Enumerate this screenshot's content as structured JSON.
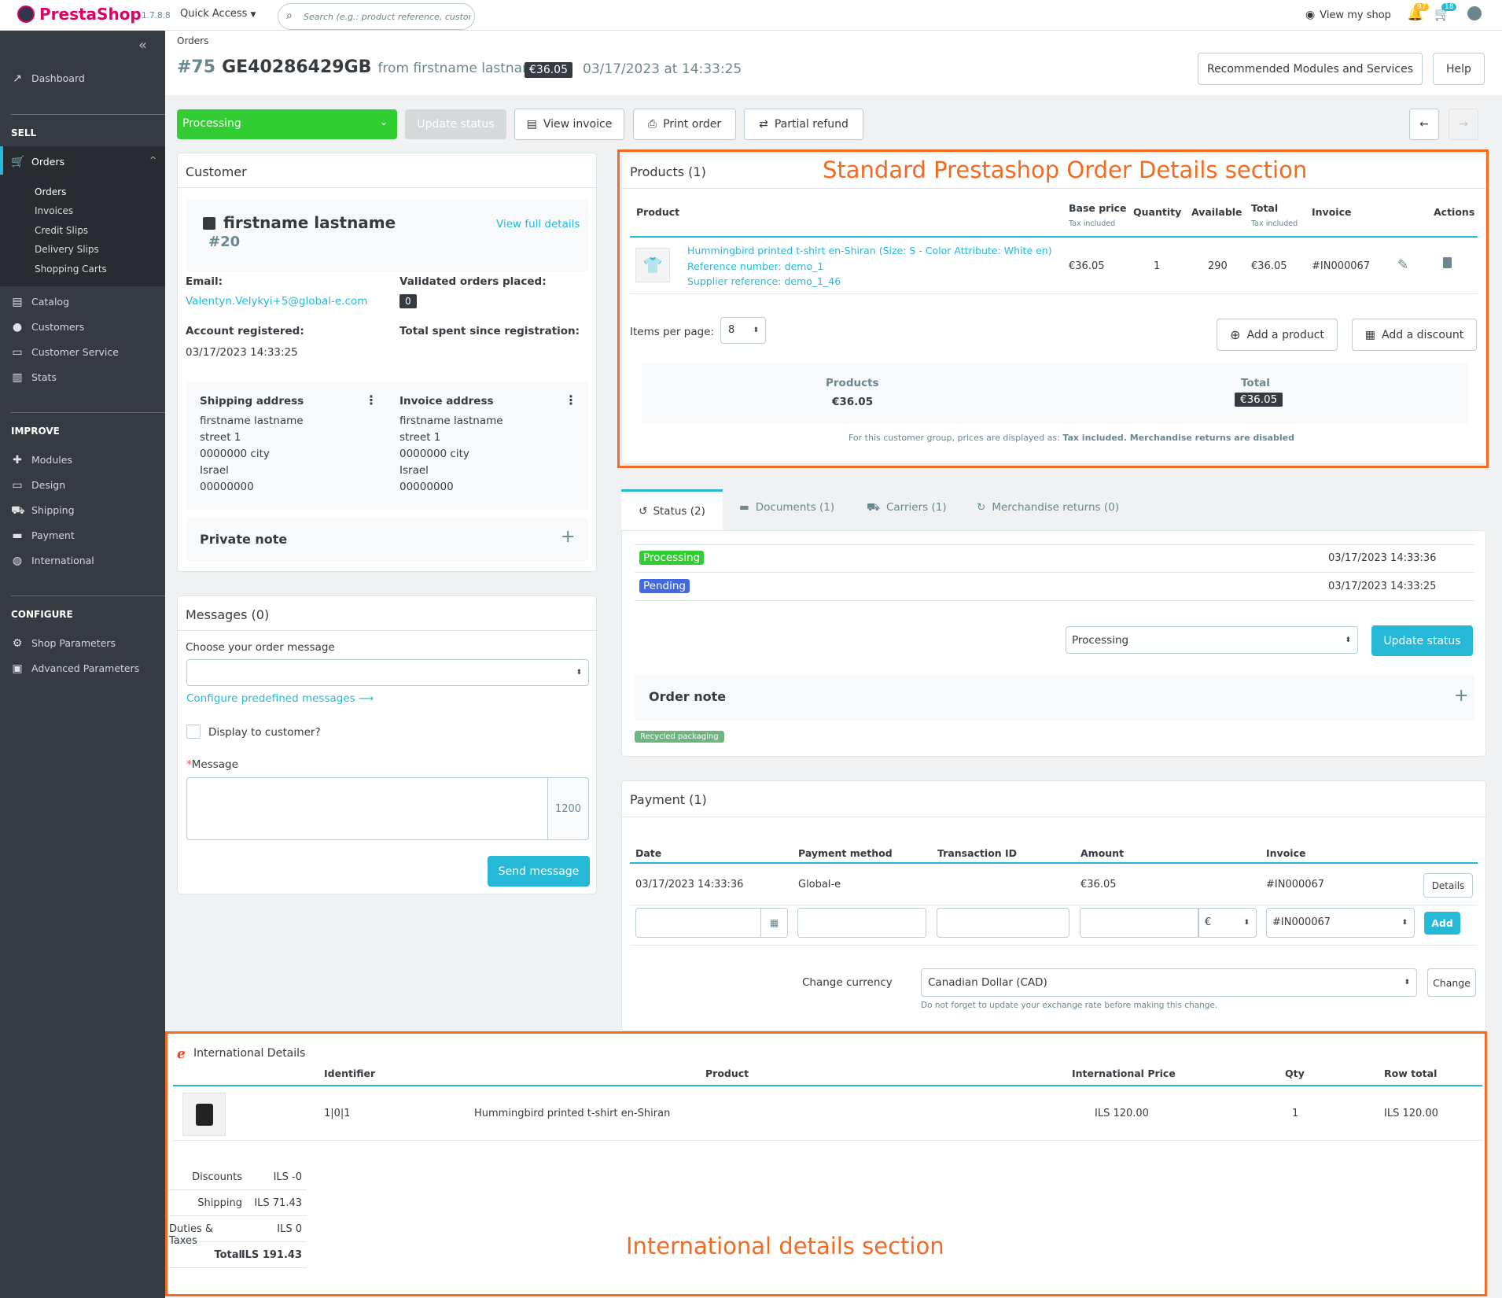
{
  "topbar": {
    "logo_text": "PrestaShop",
    "version": "1.7.8.8",
    "quick_access": "Quick Access",
    "search_placeholder": "Search (e.g.: product reference, custon",
    "view_shop": "View my shop",
    "notif_orders": "97",
    "notif_customers": "18"
  },
  "sidebar": {
    "dashboard": "Dashboard",
    "sell": "SELL",
    "orders": "Orders",
    "orders_sub": [
      "Orders",
      "Invoices",
      "Credit Slips",
      "Delivery Slips",
      "Shopping Carts"
    ],
    "catalog": "Catalog",
    "customers": "Customers",
    "customer_service": "Customer Service",
    "stats": "Stats",
    "improve": "IMPROVE",
    "modules": "Modules",
    "design": "Design",
    "shipping": "Shipping",
    "payment": "Payment",
    "international": "International",
    "configure": "CONFIGURE",
    "shop_parameters": "Shop Parameters",
    "advanced_parameters": "Advanced Parameters"
  },
  "header": {
    "breadcrumb": "Orders",
    "order_number": "#75",
    "order_reference": "GE40286429GB",
    "from": "from firstname lastname",
    "total_badge": "€36.05",
    "date": "03/17/2023 at 14:33:25",
    "recommended": "Recommended Modules and Services",
    "help": "Help"
  },
  "actions": {
    "status_select": "Processing",
    "update_status": "Update status",
    "view_invoice": "View invoice",
    "print_order": "Print order",
    "partial_refund": "Partial refund"
  },
  "customer": {
    "title": "Customer",
    "name": "firstname lastname",
    "id": "#20",
    "view_full": "View full details",
    "email_label": "Email:",
    "email": "Valentyn.Velykyi+5@global-e.com",
    "validated_label": "Validated orders placed:",
    "validated_count": "0",
    "registered_label": "Account registered:",
    "registered": "03/17/2023 14:33:25",
    "total_spent_label": "Total spent since registration:",
    "shipping_title": "Shipping address",
    "invoice_title": "Invoice address",
    "shipping_lines": [
      "firstname lastname",
      "street 1",
      "0000000 city",
      "Israel",
      "00000000"
    ],
    "invoice_lines": [
      "firstname lastname",
      "street 1",
      "0000000 city",
      "Israel",
      "00000000"
    ],
    "private_note": "Private note"
  },
  "messages": {
    "title": "Messages (0)",
    "choose_label": "Choose your order message",
    "configure_link": "Configure predefined messages",
    "display_label": "Display to customer?",
    "message_label": "Message",
    "counter": "1200",
    "send": "Send message"
  },
  "products": {
    "title": "Products (1)",
    "headers": {
      "product": "Product",
      "base_price": "Base price",
      "base_price_sub": "Tax included",
      "quantity": "Quantity",
      "available": "Available",
      "total": "Total",
      "total_sub": "Tax included",
      "invoice": "Invoice",
      "actions": "Actions"
    },
    "row": {
      "name": "Hummingbird printed t-shirt en-Shiran (Size: S - Color Attribute: White en)",
      "reference": "Reference number: demo_1",
      "supplier": "Supplier reference: demo_1_46",
      "base_price": "€36.05",
      "quantity": "1",
      "available": "290",
      "total": "€36.05",
      "invoice": "#IN000067"
    },
    "items_per_page_label": "Items per page:",
    "items_per_page": "8",
    "add_product": "Add a product",
    "add_discount": "Add a discount",
    "summary_products_label": "Products",
    "summary_products_value": "€36.05",
    "summary_total_label": "Total",
    "summary_total_value": "€36.05",
    "note_prefix": "For this customer group, prices are displayed as: ",
    "note_bold": "Tax included. Merchandise returns are disabled"
  },
  "annotation_top": "Standard Prestashop Order Details section",
  "annotation_bottom": "International details section",
  "tabs": {
    "status": "Status (2)",
    "documents": "Documents (1)",
    "carriers": "Carriers (1)",
    "returns": "Merchandise returns (0)"
  },
  "status_history": [
    {
      "label": "Processing",
      "date": "03/17/2023 14:33:36",
      "color": "#32cd32"
    },
    {
      "label": "Pending",
      "date": "03/17/2023 14:33:25",
      "color": "#4169e1"
    }
  ],
  "status_update": {
    "select": "Processing",
    "button": "Update status"
  },
  "order_note": "Order note",
  "recycled": "Recycled packaging",
  "payment": {
    "title": "Payment (1)",
    "headers": {
      "date": "Date",
      "method": "Payment method",
      "transaction": "Transaction ID",
      "amount": "Amount",
      "invoice": "Invoice"
    },
    "row": {
      "date": "03/17/2023 14:33:36",
      "method": "Global-e",
      "amount": "€36.05",
      "invoice": "#IN000067",
      "details": "Details"
    },
    "currency_symbol": "€",
    "invoice_select": "#IN000067",
    "add": "Add",
    "change_currency_label": "Change currency",
    "currency": "Canadian Dollar (CAD)",
    "change": "Change",
    "currency_note": "Do not forget to update your exchange rate before making this change."
  },
  "international": {
    "title": "International Details",
    "headers": {
      "identifier": "Identifier",
      "product": "Product",
      "price": "International Price",
      "qty": "Qty",
      "row_total": "Row total"
    },
    "row": {
      "identifier": "1|0|1",
      "product": "Hummingbird printed t-shirt en-Shiran",
      "price": "ILS 120.00",
      "qty": "1",
      "row_total": "ILS 120.00"
    },
    "totals": [
      {
        "label": "Discounts",
        "value": "ILS -0"
      },
      {
        "label": "Shipping",
        "value": "ILS 71.43"
      },
      {
        "label": "Duties & Taxes",
        "value": "ILS 0"
      },
      {
        "label": "Total",
        "value": "ILS 191.43"
      }
    ]
  }
}
